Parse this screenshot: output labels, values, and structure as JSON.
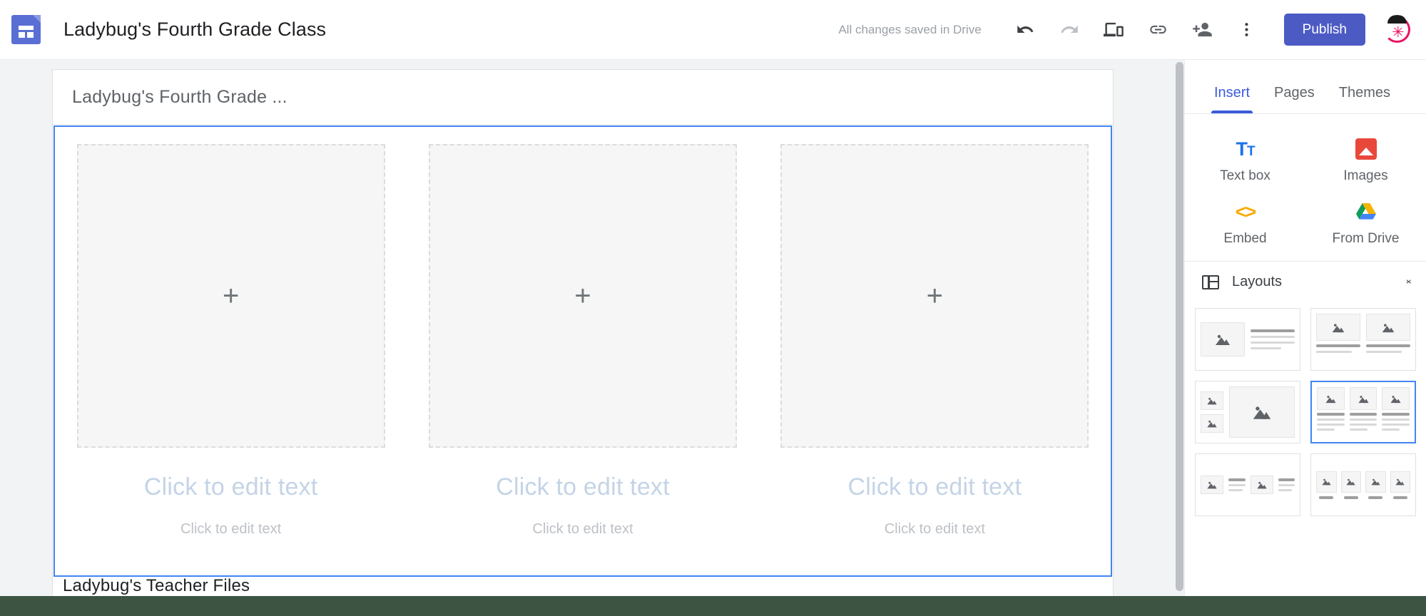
{
  "topbar": {
    "logo_icon": "google-sites-logo",
    "doc_title": "Ladybug's Fourth Grade Class",
    "save_status": "All changes saved in Drive",
    "undo_icon": "undo-icon",
    "redo_icon": "redo-icon",
    "preview_icon": "preview-devices-icon",
    "link_icon": "link-icon",
    "share_icon": "add-person-icon",
    "more_icon": "more-vertical-icon",
    "publish_label": "Publish",
    "avatar_icon": "ladybug-avatar"
  },
  "canvas": {
    "page_title": "Ladybug's Fourth Grade ...",
    "footer_text": "Ladybug's Teacher Files",
    "columns": [
      {
        "plus_icon": "plus-icon",
        "caption_large": "Click to edit text",
        "caption_small": "Click to edit text"
      },
      {
        "plus_icon": "plus-icon",
        "caption_large": "Click to edit text",
        "caption_small": "Click to edit text"
      },
      {
        "plus_icon": "plus-icon",
        "caption_large": "Click to edit text",
        "caption_small": "Click to edit text"
      }
    ]
  },
  "panel": {
    "tabs": [
      {
        "label": "Insert",
        "active": true
      },
      {
        "label": "Pages",
        "active": false
      },
      {
        "label": "Themes",
        "active": false
      }
    ],
    "insert_items": [
      {
        "label": "Text box",
        "icon": "text-box-icon"
      },
      {
        "label": "Images",
        "icon": "images-icon"
      },
      {
        "label": "Embed",
        "icon": "embed-code-icon"
      },
      {
        "label": "From Drive",
        "icon": "google-drive-icon"
      }
    ],
    "layouts": {
      "icon": "layouts-icon",
      "label": "Layouts",
      "toggle_icon": "collapse-expand-chevrons",
      "options": [
        {
          "name": "image-left-text-right",
          "selected": false
        },
        {
          "name": "two-column-image-text",
          "selected": false
        },
        {
          "name": "two-small-images-one-large",
          "selected": false
        },
        {
          "name": "three-column-image-text",
          "selected": true
        },
        {
          "name": "two-inline-image-text",
          "selected": false
        },
        {
          "name": "four-column-image-caption",
          "selected": false
        }
      ]
    }
  },
  "colors": {
    "accent_blue": "#4285f4",
    "publish_blue": "#4c5bc4",
    "tab_blue": "#3b5bdb",
    "bottom_bar": "#3d5443",
    "workspace_grey": "#f1f3f4",
    "caption_large": "#c4d4e6"
  }
}
